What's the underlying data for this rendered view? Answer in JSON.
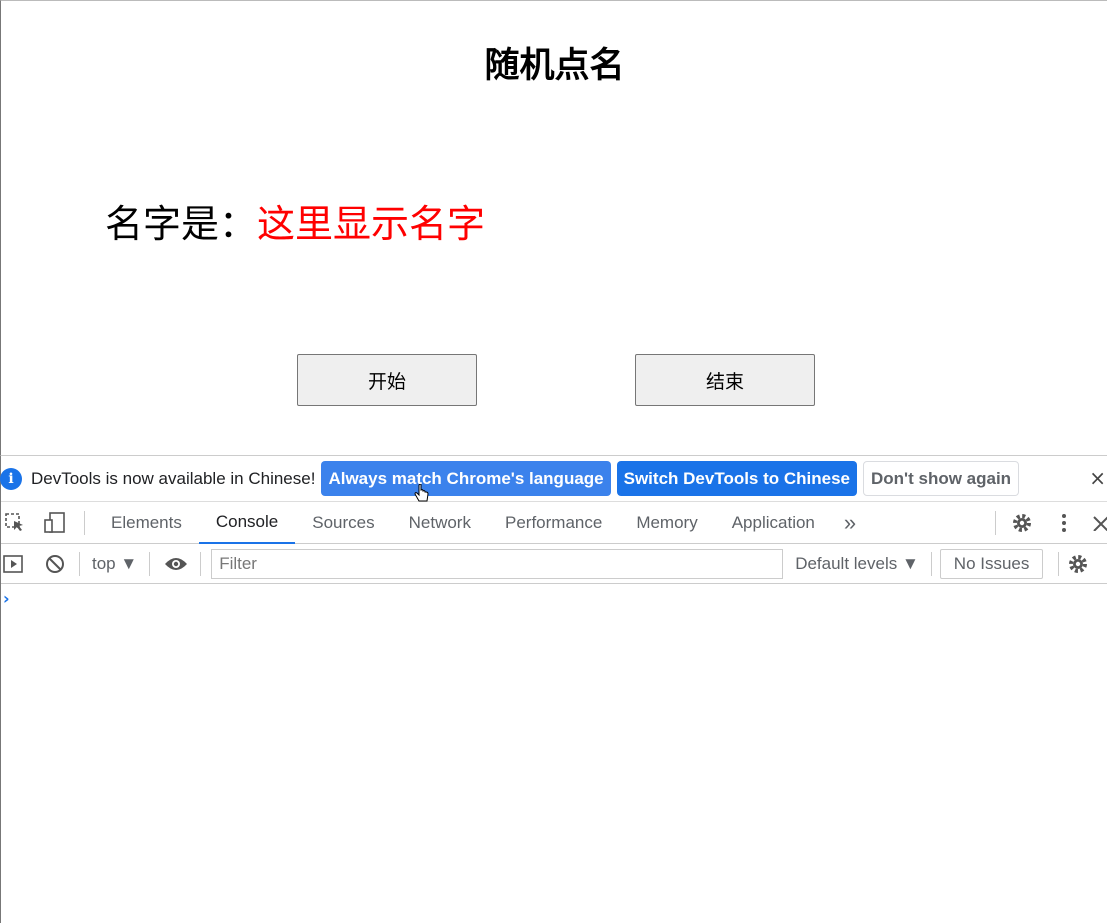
{
  "page": {
    "title": "随机点名",
    "name_label": "名字是：",
    "name_value": "这里显示名字",
    "start_button": "开始",
    "end_button": "结束",
    "name_color": "#ff0000"
  },
  "devtools": {
    "infobar": {
      "icon": "info-icon",
      "message": "DevTools is now available in Chinese!",
      "match_language": "Always match Chrome's language",
      "switch_language": "Switch DevTools to Chinese",
      "dont_show": "Don't show again",
      "close": "×"
    },
    "tabs": [
      "Elements",
      "Console",
      "Sources",
      "Network",
      "Performance",
      "Memory",
      "Application"
    ],
    "active_tab": "Console",
    "more_tabs": "»",
    "console": {
      "context": "top ▼",
      "filter_placeholder": "Filter",
      "levels": "Default levels ▼",
      "issues": "No Issues",
      "prompt": "›"
    },
    "accent_color": "#1a73e8"
  }
}
